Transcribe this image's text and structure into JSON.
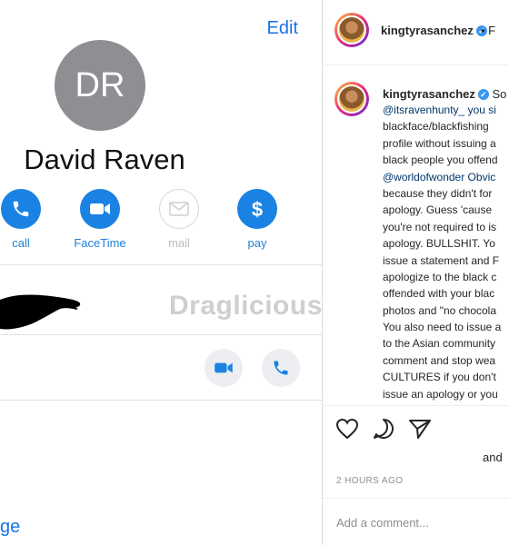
{
  "contact": {
    "edit_label": "Edit",
    "initials": "DR",
    "name": "David Raven",
    "actions": [
      {
        "label": "call",
        "icon": "phone-icon",
        "enabled": true
      },
      {
        "label": "FaceTime",
        "icon": "video-icon",
        "enabled": true
      },
      {
        "label": "mail",
        "icon": "mail-icon",
        "enabled": false
      },
      {
        "label": "pay",
        "icon": "dollar-icon",
        "enabled": true
      }
    ],
    "watermark": "Draglicious",
    "message_link": "ge",
    "accent_color": "#1a73e8"
  },
  "instagram": {
    "username": "kingtyrasanchez",
    "follow_fragment": "• F",
    "caption_lines": [
      {
        "text": "So",
        "type": "text"
      },
      {
        "text": "@itsravenhunty_ you si",
        "type": "mention-start"
      },
      {
        "text": "blackface/blackfishing",
        "type": "text"
      },
      {
        "text": "profile without issuing a",
        "type": "text"
      },
      {
        "text": "black people you offend",
        "type": "text"
      },
      {
        "text": "@worldofwonder Obvic",
        "type": "mention-start"
      },
      {
        "text": "because they didn't for",
        "type": "text"
      },
      {
        "text": "apology. Guess 'cause",
        "type": "text"
      },
      {
        "text": "you're not required to is",
        "type": "text"
      },
      {
        "text": "apology. BULLSHIT. Yo",
        "type": "text"
      },
      {
        "text": "issue a statement and F",
        "type": "text"
      },
      {
        "text": "apologize to the black c",
        "type": "text"
      },
      {
        "text": "offended with your blac",
        "type": "text"
      },
      {
        "text": "photos and \"no chocola",
        "type": "text"
      },
      {
        "text": "You also need to issue a",
        "type": "text"
      },
      {
        "text": "to the Asian community",
        "type": "text"
      },
      {
        "text": "comment and stop wea",
        "type": "text"
      },
      {
        "text": "CULTURES if you don't",
        "type": "text"
      },
      {
        "text": "issue an apology or you",
        "type": "text"
      }
    ],
    "likes_fragment": "and",
    "timestamp": "2 HOURS AGO",
    "comment_placeholder": "Add a comment..."
  }
}
